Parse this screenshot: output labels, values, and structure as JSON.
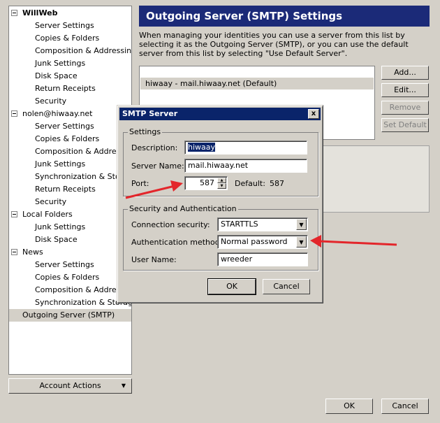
{
  "tree": {
    "items": [
      {
        "label": "WillWeb",
        "level": 0,
        "bold": true,
        "expander": true
      },
      {
        "label": "Server Settings",
        "level": 1
      },
      {
        "label": "Copies & Folders",
        "level": 1
      },
      {
        "label": "Composition & Addressing",
        "level": 1
      },
      {
        "label": "Junk Settings",
        "level": 1
      },
      {
        "label": "Disk Space",
        "level": 1
      },
      {
        "label": "Return Receipts",
        "level": 1
      },
      {
        "label": "Security",
        "level": 1
      },
      {
        "label": "nolen@hiwaay.net",
        "level": 0,
        "expander": true
      },
      {
        "label": "Server Settings",
        "level": 1
      },
      {
        "label": "Copies & Folders",
        "level": 1
      },
      {
        "label": "Composition & Addressing",
        "level": 1
      },
      {
        "label": "Junk Settings",
        "level": 1
      },
      {
        "label": "Synchronization & Storage",
        "level": 1
      },
      {
        "label": "Return Receipts",
        "level": 1
      },
      {
        "label": "Security",
        "level": 1
      },
      {
        "label": "Local Folders",
        "level": 0,
        "expander": true
      },
      {
        "label": "Junk Settings",
        "level": 1
      },
      {
        "label": "Disk Space",
        "level": 1
      },
      {
        "label": "News",
        "level": 0,
        "expander": true
      },
      {
        "label": "Server Settings",
        "level": 1
      },
      {
        "label": "Copies & Folders",
        "level": 1
      },
      {
        "label": "Composition & Addressing",
        "level": 1
      },
      {
        "label": "Synchronization & Storage",
        "level": 1
      },
      {
        "label": "Outgoing Server (SMTP)",
        "level": 0,
        "selected": true
      }
    ]
  },
  "account_actions": {
    "label": "Account Actions"
  },
  "panel": {
    "title": "Outgoing Server (SMTP) Settings",
    "description": "When managing your identities you can use a server from this list by selecting it as the Outgoing Server (SMTP), or you can use the default server from this list by selecting \"Use Default Server\".",
    "servers": [
      "hiwaay - mail.hiwaay.net (Default)"
    ],
    "buttons": {
      "add": "Add...",
      "edit": "Edit...",
      "remove": "Remove",
      "set_default": "Set Default"
    }
  },
  "footer": {
    "ok": "OK",
    "cancel": "Cancel"
  },
  "dialog": {
    "title": "SMTP Server",
    "close": "x",
    "settings_group": "Settings",
    "description_label": "Description:",
    "description_value": "hiwaay",
    "server_name_label": "Server Name:",
    "server_name_value": "mail.hiwaay.net",
    "port_label": "Port:",
    "port_value": "587",
    "default_label": "Default:",
    "default_value": "587",
    "security_group": "Security and Authentication",
    "connection_security_label": "Connection security:",
    "connection_security_value": "STARTTLS",
    "auth_method_label": "Authentication method:",
    "auth_method_value": "Normal password",
    "user_name_label": "User Name:",
    "user_name_value": "wreeder",
    "ok": "OK",
    "cancel": "Cancel"
  },
  "colors": {
    "annotation_arrow": "#e3262b",
    "title_bar": "#0a246a",
    "panel_header": "#1b2a78"
  }
}
